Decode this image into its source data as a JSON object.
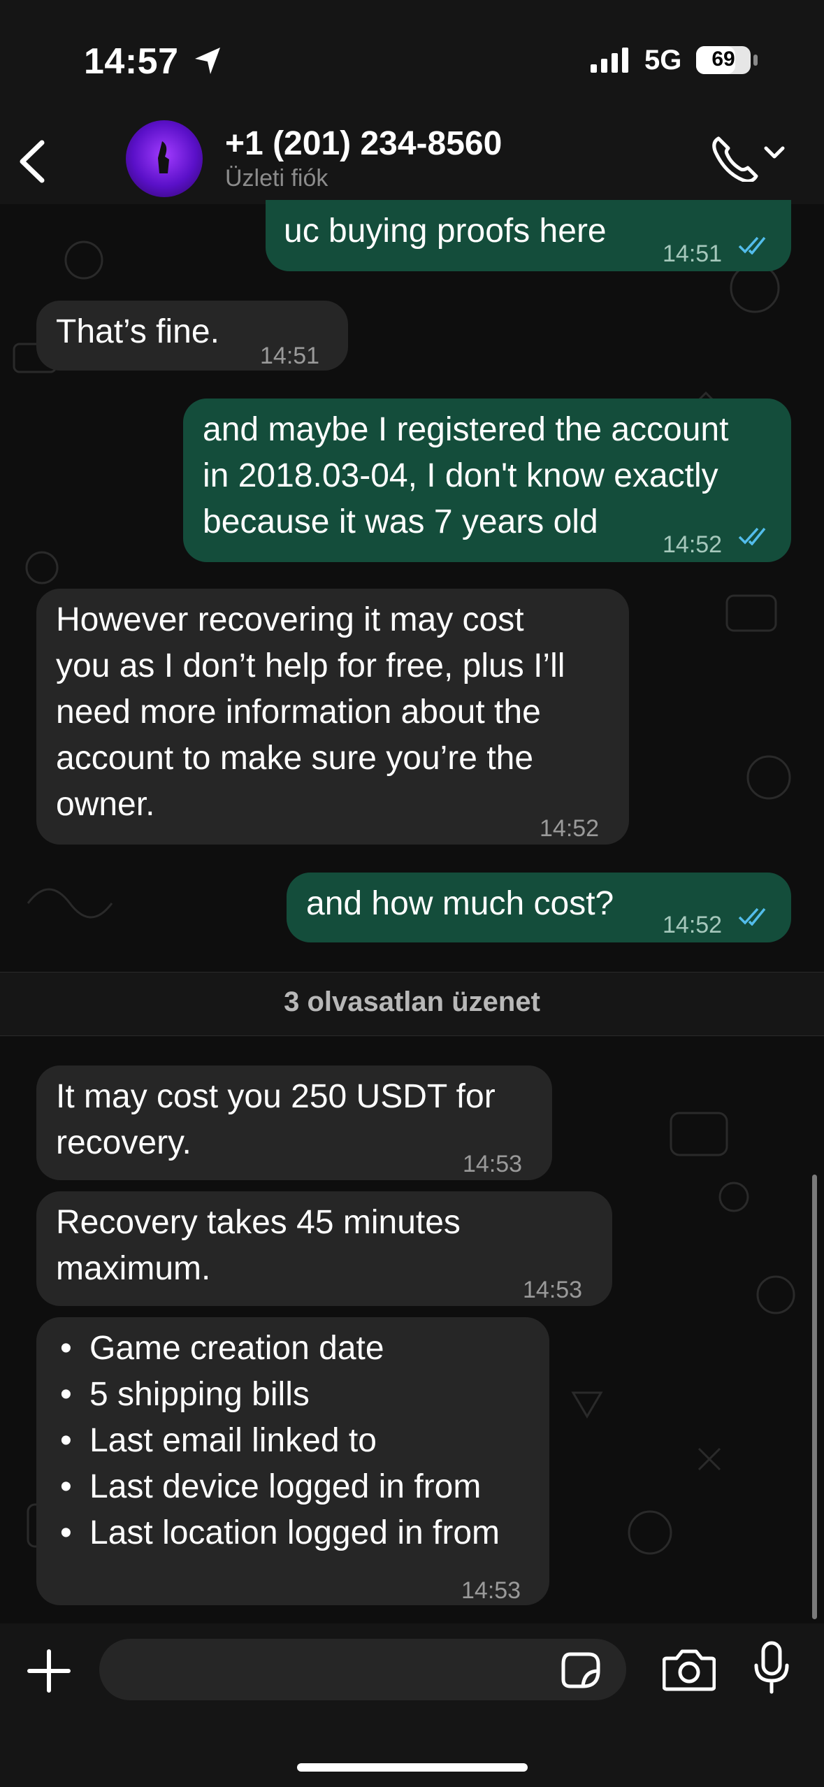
{
  "status_bar": {
    "time": "14:57",
    "network": "5G",
    "battery": "69"
  },
  "header": {
    "contact_name": "+1 (201) 234-8560",
    "subtitle": "Üzleti fiók"
  },
  "messages": [
    {
      "direction": "out",
      "text": "uc buying proofs here",
      "time": "14:51",
      "read": true
    },
    {
      "direction": "in",
      "text": "That’s fine.",
      "time": "14:51"
    },
    {
      "direction": "out",
      "text": "and maybe I registered the account\nin 2018.03-04, I don't know exactly\nbecause it was 7 years old",
      "time": "14:52",
      "read": true
    },
    {
      "direction": "in",
      "text": "However recovering it may cost\nyou as I don’t help for free, plus I’ll\nneed more information about the\naccount to make sure you’re the\nowner.",
      "time": "14:52"
    },
    {
      "direction": "out",
      "text": "and how much cost?",
      "time": "14:52",
      "read": true
    },
    {
      "direction": "in",
      "text": "It may cost you 250 USDT for\nrecovery.",
      "time": "14:53"
    },
    {
      "direction": "in",
      "text": "Recovery takes 45 minutes\nmaximum.",
      "time": "14:53"
    },
    {
      "direction": "in",
      "list": [
        "Game creation date",
        "5 shipping bills",
        "Last email linked to",
        "Last device logged in from",
        "Last location logged in from"
      ],
      "time": "14:53"
    }
  ],
  "unread_divider": "3 olvasatlan üzenet",
  "colors": {
    "outgoing_bubble": "#144d3b",
    "incoming_bubble": "#262626",
    "read_ticks": "#53bdeb"
  },
  "icons": {
    "back": "chevron-left-icon",
    "call": "phone-icon",
    "attach": "plus-icon",
    "sticker": "sticker-icon",
    "camera": "camera-icon",
    "mic": "microphone-icon"
  }
}
